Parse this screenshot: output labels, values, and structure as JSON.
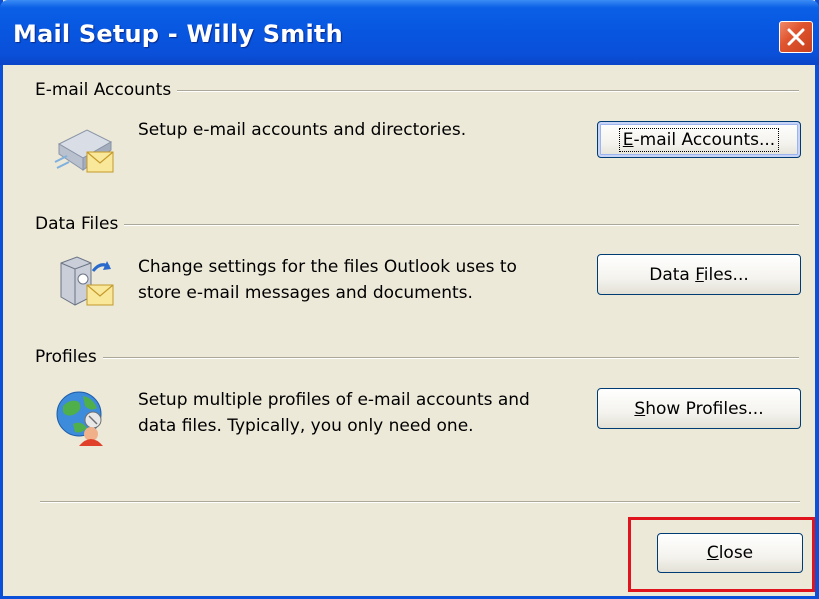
{
  "window": {
    "title": "Mail Setup - Willy Smith"
  },
  "sections": {
    "email_accounts": {
      "label": "E-mail Accounts",
      "description": "Setup e-mail accounts and directories.",
      "button_pre": "",
      "button_mnemonic": "E",
      "button_post": "-mail Accounts..."
    },
    "data_files": {
      "label": "Data Files",
      "description_line1": "Change settings for the files Outlook uses to",
      "description_line2": "store e-mail messages and documents.",
      "button_pre": "Data ",
      "button_mnemonic": "F",
      "button_post": "iles..."
    },
    "profiles": {
      "label": "Profiles",
      "description_line1": "Setup multiple profiles of e-mail accounts and",
      "description_line2": "data files. Typically, you only need one.",
      "button_pre": "",
      "button_mnemonic": "S",
      "button_post": "how Profiles..."
    }
  },
  "footer": {
    "close_pre": "",
    "close_mnemonic": "C",
    "close_post": "lose"
  },
  "icons": {
    "title_close": "close-icon",
    "email_accounts": "email-accounts-icon",
    "data_files": "data-files-icon",
    "profiles": "profiles-globe-icon"
  },
  "colors": {
    "titlebar": "#0856e0",
    "dialog_bg": "#ece9d8",
    "close_button": "#e0552f",
    "highlight_box": "#e0141c"
  }
}
